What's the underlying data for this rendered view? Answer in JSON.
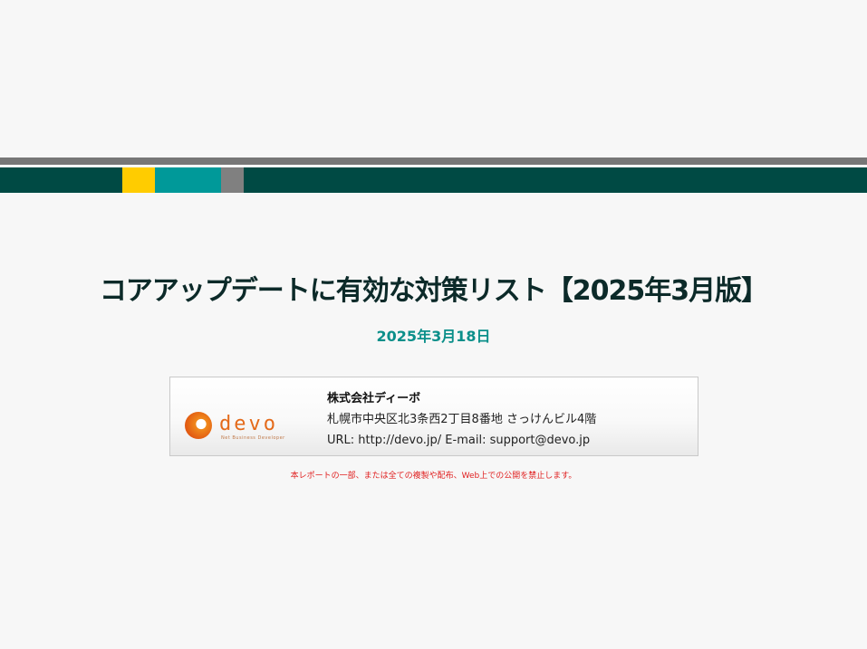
{
  "document": {
    "title": "コアアップデートに有効な対策リスト【2025年3月版】",
    "date": "2025年3月18日",
    "notice": "本レポートの一部、または全ての複製や配布、Web上での公開を禁止します。"
  },
  "company": {
    "logo_text": "devo",
    "logo_tagline": "Net Business Developer",
    "name": "株式会社ディーボ",
    "address": "札幌市中央区北3条西2丁目8番地 さっけんビル4階",
    "contact": "URL: http://devo.jp/   E-mail: support@devo.jp"
  },
  "colors": {
    "header_gray": "#777777",
    "header_green": "#004a44",
    "accent_yellow": "#ffcc00",
    "accent_teal": "#009999",
    "accent_gray": "#808080",
    "date_teal": "#0b8f8a",
    "notice_red": "#e02020",
    "logo_orange": "#e46a1a"
  }
}
